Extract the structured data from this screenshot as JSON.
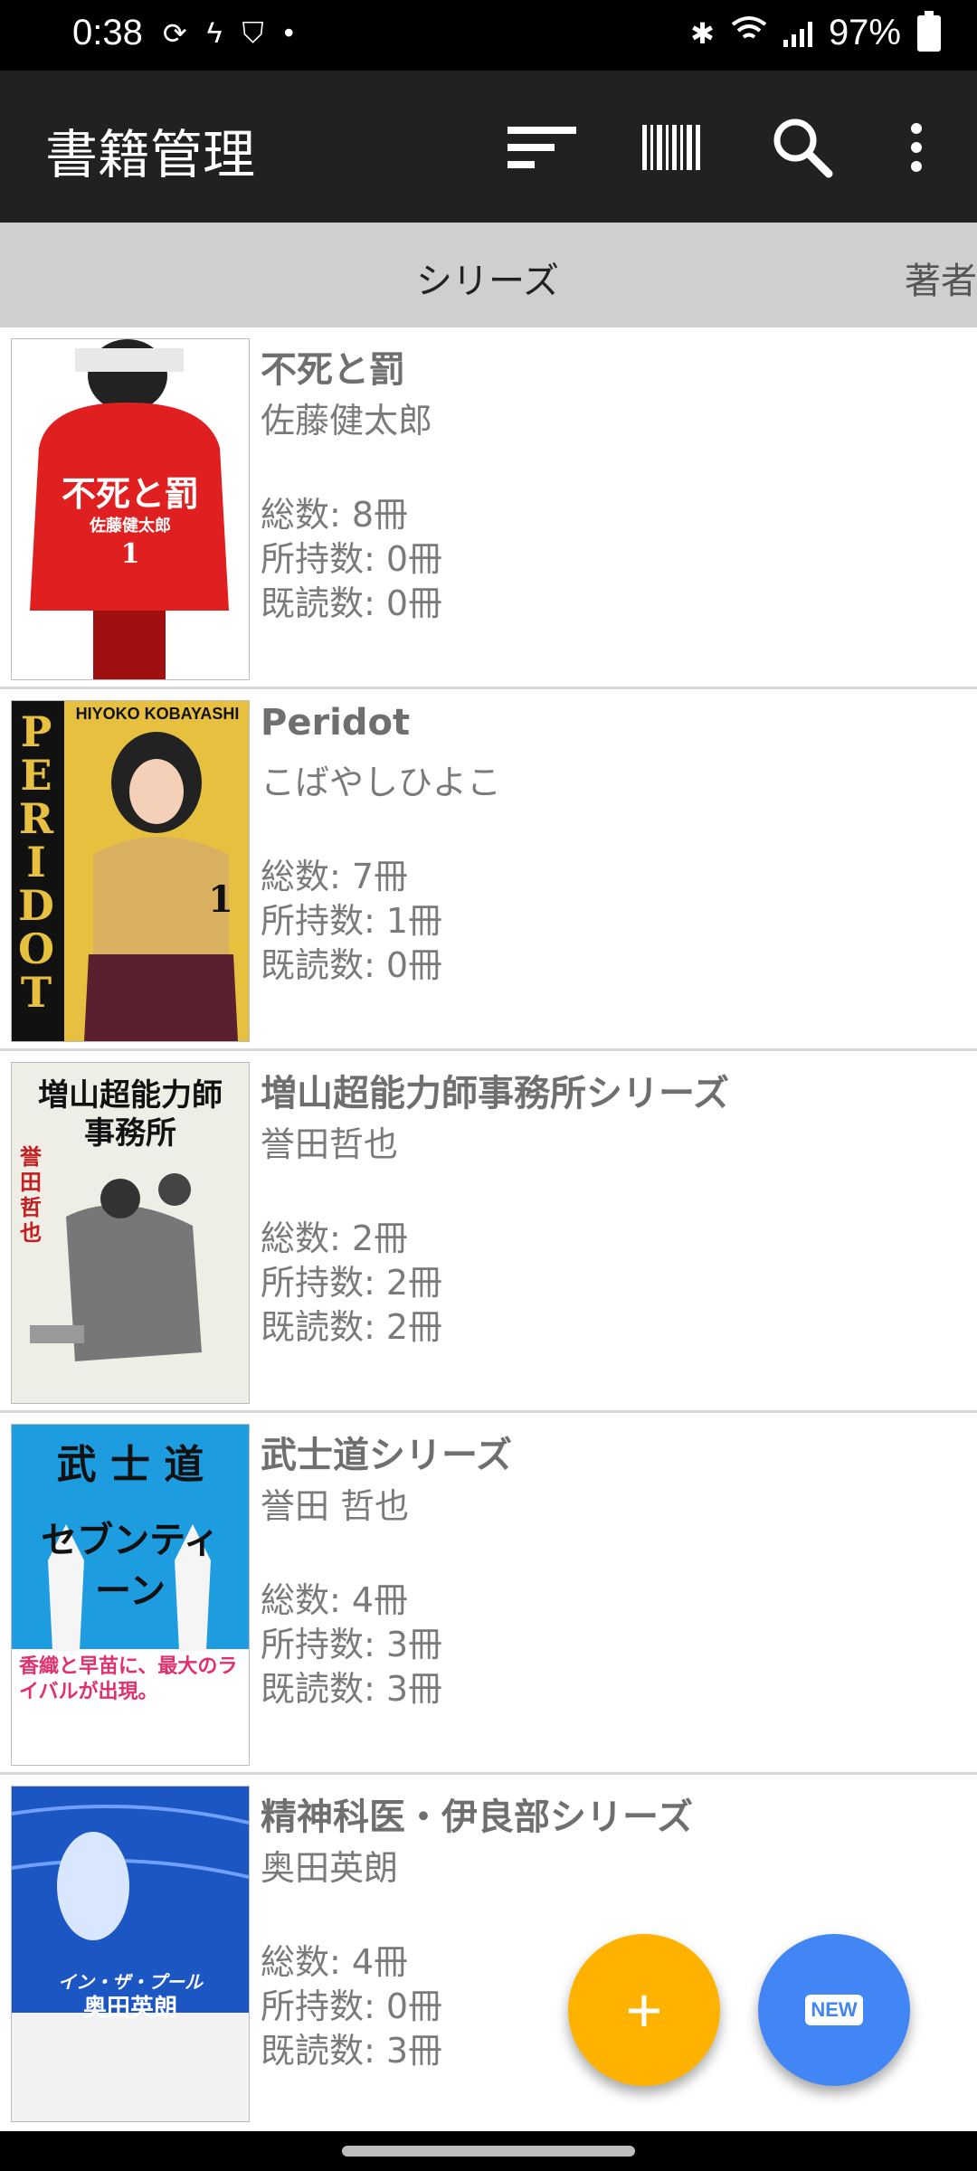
{
  "status_bar": {
    "time": "0:38",
    "battery": "97%"
  },
  "app_bar": {
    "title": "書籍管理"
  },
  "tabs": {
    "series": "シリーズ",
    "author": "著者"
  },
  "series": [
    {
      "title": "不死と罰",
      "author": "佐藤健太郎",
      "total": "総数: 8冊",
      "owned": "所持数: 0冊",
      "read": "既読数: 0冊",
      "cover_text": "不死と罰",
      "cover_sub": "佐藤健太郎",
      "cover_num": "1"
    },
    {
      "title": "Peridot",
      "author": "こばやしひよこ",
      "total": "総数: 7冊",
      "owned": "所持数: 1冊",
      "read": "既読数: 0冊",
      "cover_text": "PERIDOT",
      "cover_sub": "HIYOKO KOBAYASHI",
      "cover_num": "1"
    },
    {
      "title": "増山超能力師事務所シリーズ",
      "author": "誉田哲也",
      "total": "総数: 2冊",
      "owned": "所持数: 2冊",
      "read": "既読数: 2冊",
      "cover_text": "増山超能力師",
      "cover_sub": "事務所",
      "cover_num": "誉田哲也"
    },
    {
      "title": "武士道シリーズ",
      "author": "誉田 哲也",
      "total": "総数: 4冊",
      "owned": "所持数: 3冊",
      "read": "既読数: 3冊",
      "cover_text": "武 士 道",
      "cover_sub": "セブンティーン",
      "cover_num": "香織と早苗に、最大のライバルが出現。"
    },
    {
      "title": "精神科医・伊良部シリーズ",
      "author": "奥田英朗",
      "total": "総数: 4冊",
      "owned": "所持数: 0冊",
      "read": "既読数: 3冊",
      "cover_text": "イン・ザ・プール",
      "cover_sub": "奥田英朗",
      "cover_num": ""
    }
  ],
  "fabs": {
    "add_symbol": "+",
    "new_label": "NEW"
  },
  "colors": {
    "app_bar": "#212121",
    "tab_bar": "#cfcfcf",
    "fab_add": "#FFB300",
    "fab_new": "#4285F4"
  }
}
